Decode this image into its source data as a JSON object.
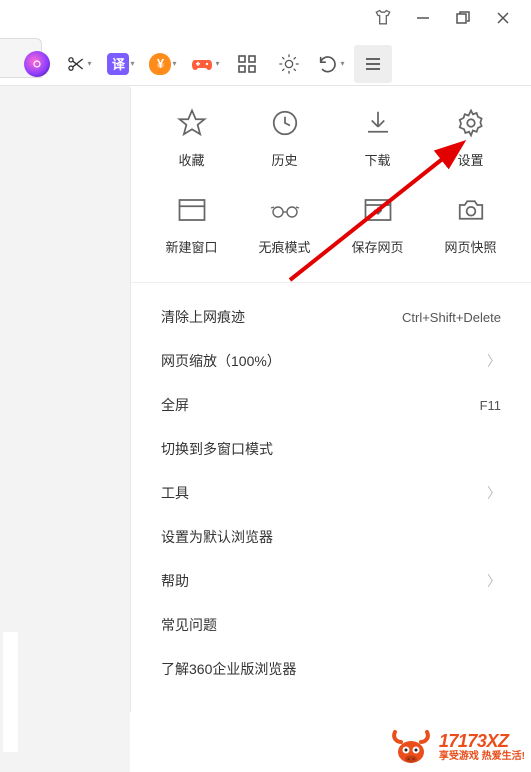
{
  "window": {
    "tshirt_icon": "tshirt",
    "minimize_icon": "minimize",
    "maximize_icon": "maximize",
    "close_icon": "close"
  },
  "toolbar": {
    "camera_icon": "camera",
    "scissors_icon": "scissors",
    "translate_label": "译",
    "translate_color": "#7b5cff",
    "money_label": "¥",
    "money_color": "#ff8c1a",
    "game_icon": "gamepad",
    "game_color": "#ff5e3a",
    "grid_icon": "grid",
    "theme_icon": "sun",
    "undo_icon": "undo",
    "menu_icon": "hamburger"
  },
  "grid": [
    {
      "icon": "star",
      "label": "收藏"
    },
    {
      "icon": "clock",
      "label": "历史"
    },
    {
      "icon": "download",
      "label": "下载"
    },
    {
      "icon": "gear",
      "label": "设置"
    },
    {
      "icon": "window",
      "label": "新建窗口"
    },
    {
      "icon": "incognito",
      "label": "无痕模式"
    },
    {
      "icon": "save-page",
      "label": "保存网页"
    },
    {
      "icon": "camera-snap",
      "label": "网页快照"
    }
  ],
  "menu": [
    {
      "label": "清除上网痕迹",
      "shortcut": "Ctrl+Shift+Delete"
    },
    {
      "label": "网页缩放（100%）",
      "chevron": true
    },
    {
      "label": "全屏",
      "shortcut": "F11"
    },
    {
      "label": "切换到多窗口模式"
    },
    {
      "label": "工具",
      "chevron": true
    },
    {
      "label": "设置为默认浏览器"
    },
    {
      "label": "帮助",
      "chevron": true
    },
    {
      "label": "常见问题"
    },
    {
      "label": "了解360企业版浏览器"
    }
  ],
  "watermark": {
    "main": "17173XZ",
    "sub": "享受游戏 热爱生活!"
  }
}
